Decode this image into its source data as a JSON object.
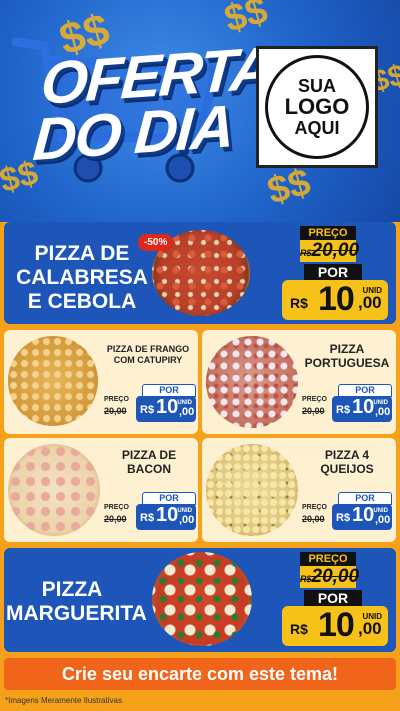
{
  "header": {
    "title_line1": "OFERTA",
    "title_line2": "DO DIA",
    "logo": {
      "line1": "SUA",
      "line2": "LOGO",
      "line3": "AQUI"
    }
  },
  "colors": {
    "blue": "#1d56b8",
    "yellow": "#f6c21a",
    "orange": "#f0651a",
    "cream": "#fdf1d2"
  },
  "featured": [
    {
      "name_line1": "PIZZA DE",
      "name_line2": "CALABRESA",
      "name_line3": "E CEBOLA",
      "discount": "-50%",
      "preco_label": "PREÇO",
      "old_price": "20,00",
      "por_label": "POR",
      "currency": "R$",
      "price_int": "10",
      "price_cents": ",00",
      "unit": "UNID"
    },
    {
      "name_line1": "PIZZA",
      "name_line2": "MARGUERITA",
      "preco_label": "PREÇO",
      "old_price": "20,00",
      "por_label": "POR",
      "currency": "R$",
      "price_int": "10",
      "price_cents": ",00",
      "unit": "UNID"
    }
  ],
  "grid": [
    {
      "name_line1": "PIZZA DE FRANGO",
      "name_line2": "COM CATUPIRY",
      "preco_label": "PREÇO",
      "old_price": "20,00",
      "por_label": "POR",
      "currency": "R$",
      "price_int": "10",
      "price_cents": ",00",
      "unit": "UNID"
    },
    {
      "name_line1": "PIZZA",
      "name_line2": "PORTUGUESA",
      "preco_label": "PREÇO",
      "old_price": "20,00",
      "por_label": "POR",
      "currency": "R$",
      "price_int": "10",
      "price_cents": ",00",
      "unit": "UNID"
    },
    {
      "name_line1": "PIZZA DE",
      "name_line2": "BACON",
      "preco_label": "PREÇO",
      "old_price": "20,00",
      "por_label": "POR",
      "currency": "R$",
      "price_int": "10",
      "price_cents": ",00",
      "unit": "UNID"
    },
    {
      "name_line1": "PIZZA 4",
      "name_line2": "QUEIJOS",
      "preco_label": "PREÇO",
      "old_price": "20,00",
      "por_label": "POR",
      "currency": "R$",
      "price_int": "10",
      "price_cents": ",00",
      "unit": "UNID"
    }
  ],
  "footer": {
    "cta": "Crie seu encarte com este tema!",
    "disclaimer": "*Imagens Meramente Ilustrativas"
  }
}
